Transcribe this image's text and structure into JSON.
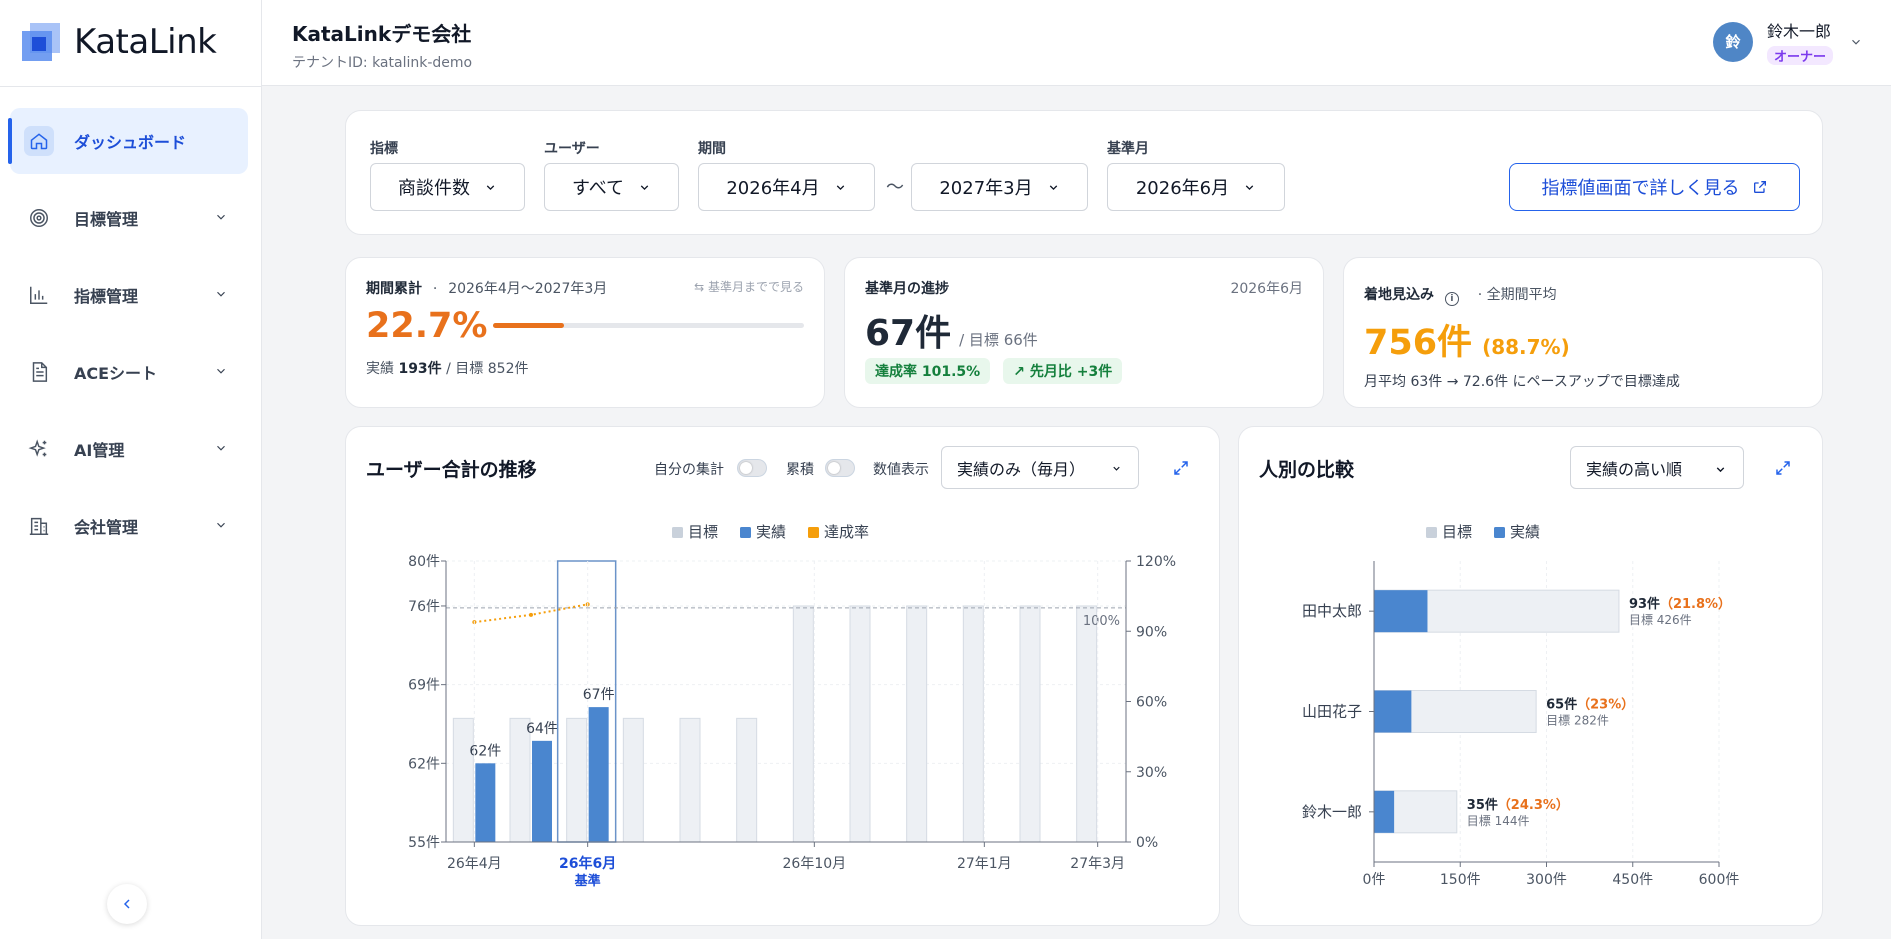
{
  "app": {
    "logo_text": "KataLink"
  },
  "header": {
    "company": "KataLinkデモ会社",
    "tenant": "テナントID: katalink-demo",
    "user_name": "鈴木一郎",
    "avatar_initial": "鈴",
    "role": "オーナー"
  },
  "sidebar": {
    "items": [
      {
        "label": "ダッシュボード",
        "icon": "home-icon",
        "active": true
      },
      {
        "label": "目標管理",
        "icon": "target-icon"
      },
      {
        "label": "指標管理",
        "icon": "bar-chart-icon"
      },
      {
        "label": "ACEシート",
        "icon": "document-icon"
      },
      {
        "label": "AI管理",
        "icon": "sparkles-icon"
      },
      {
        "label": "会社管理",
        "icon": "building-icon"
      }
    ]
  },
  "filters": {
    "metric_label": "指標",
    "metric_value": "商談件数",
    "user_label": "ユーザー",
    "user_value": "すべて",
    "period_label": "期間",
    "period_from": "2026年4月",
    "period_sep": "〜",
    "period_to": "2027年3月",
    "base_label": "基準月",
    "base_value": "2026年6月",
    "detail_button": "指標値画面で詳しく見る"
  },
  "stat_cumulative": {
    "title": "期間累計",
    "range": "2026年4月〜2027年3月",
    "link": "基準月までで見る",
    "percent": "22.7%",
    "progress": 0.227,
    "footer_prefix": "実績 ",
    "actual": "193件",
    "footer_mid": " / 目標 852件"
  },
  "stat_base": {
    "title": "基準月の進捗",
    "month": "2026年6月",
    "value": "67件",
    "target": "/ 目標 66件",
    "achievement": "達成率 101.5%",
    "mom": "先月比 +3件"
  },
  "stat_forecast": {
    "title": "着地見込み",
    "sub": "· 全期間平均",
    "value": "756件",
    "percent": "(88.7%)",
    "note": "月平均 63件 → 72.6件 にペースアップで目標達成"
  },
  "trend": {
    "title": "ユーザー合計の推移",
    "toggle_self": "自分の集計",
    "toggle_cumulative": "累積",
    "values_label": "数値表示",
    "mode": "実績のみ（毎月）",
    "legend": [
      "目標",
      "実績",
      "達成率"
    ],
    "base_label": "基準",
    "ref_label": "100%"
  },
  "compare": {
    "title": "人別の比較",
    "sort": "実績の高い順",
    "legend": [
      "目標",
      "実績"
    ]
  },
  "colors": {
    "accent": "#2563eb",
    "actual": "#4a86cf",
    "target": "#e9edf2",
    "rate": "#f59e0b",
    "orange": "#e8711c"
  },
  "chart_data": [
    {
      "type": "bar",
      "title": "ユーザー合計の推移",
      "categories": [
        "26年4月",
        "26年5月",
        "26年6月",
        "26年7月",
        "26年8月",
        "26年9月",
        "26年10月",
        "26年11月",
        "26年12月",
        "27年1月",
        "27年2月",
        "27年3月"
      ],
      "x_tick_labels": [
        "26年4月",
        "26年6月",
        "26年10月",
        "27年1月",
        "27年3月"
      ],
      "series": [
        {
          "name": "目標",
          "values": [
            66,
            66,
            66,
            66,
            66,
            66,
            76,
            76,
            76,
            76,
            76,
            76
          ]
        },
        {
          "name": "実績",
          "values": [
            62,
            64,
            67,
            null,
            null,
            null,
            null,
            null,
            null,
            null,
            null,
            null
          ]
        },
        {
          "name": "達成率",
          "axis": "right",
          "values": [
            93.9,
            97.0,
            101.5,
            null,
            null,
            null,
            null,
            null,
            null,
            null,
            null,
            null
          ]
        }
      ],
      "data_labels": [
        "62件",
        "64件",
        "67件"
      ],
      "y_ticks": [
        "55件",
        "62件",
        "69件",
        "76件",
        "80件"
      ],
      "ylim": [
        55,
        80
      ],
      "y2_ticks": [
        "0%",
        "30%",
        "60%",
        "90%",
        "120%"
      ],
      "y2lim": [
        0,
        120
      ],
      "reference_y2": 100,
      "highlight": "26年6月",
      "grid": true,
      "legend": "top-center"
    },
    {
      "type": "bar",
      "orientation": "horizontal",
      "title": "人別の比較",
      "categories": [
        "田中太郎",
        "山田花子",
        "鈴木一郎"
      ],
      "series": [
        {
          "name": "目標",
          "values": [
            426,
            282,
            144
          ]
        },
        {
          "name": "実績",
          "values": [
            93,
            65,
            35
          ]
        }
      ],
      "value_labels": [
        "93件",
        "65件",
        "35件"
      ],
      "rate_labels": [
        "（21.8%）",
        "（23%）",
        "（24.3%）"
      ],
      "target_labels": [
        "目標 426件",
        "目標 282件",
        "目標 144件"
      ],
      "x_ticks": [
        "0件",
        "150件",
        "300件",
        "450件",
        "600件"
      ],
      "xlim": [
        0,
        600
      ],
      "grid": true,
      "legend": "top-center"
    }
  ]
}
